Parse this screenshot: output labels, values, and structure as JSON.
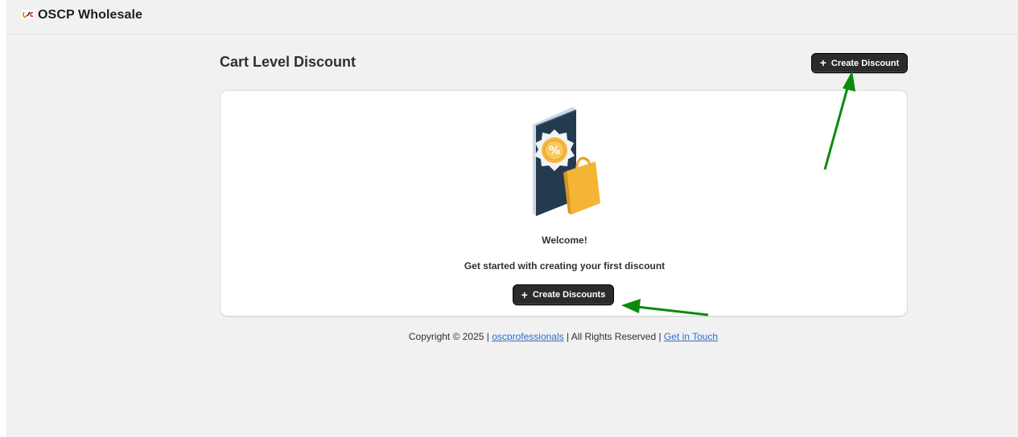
{
  "header": {
    "app_name": "OSCP Wholesale",
    "logo_icon": "oscp-logo-icon"
  },
  "page": {
    "title": "Cart Level Discount",
    "create_button_label": "Create Discount"
  },
  "empty_state": {
    "illustration_icon": "discount-phone-shopping-bag-icon",
    "heading": "Welcome!",
    "message": "Get started with creating your first discount",
    "button_label": "Create Discounts"
  },
  "footer": {
    "copyright": "Copyright © 2025 |",
    "company_link": "oscprofessionals",
    "rights": "| All Rights Reserved |",
    "contact_link": "Get in Touch"
  },
  "colors": {
    "accent_button": "#2b2b2b",
    "link": "#2c6ecb",
    "annotation_arrow": "#0b8a0b"
  }
}
